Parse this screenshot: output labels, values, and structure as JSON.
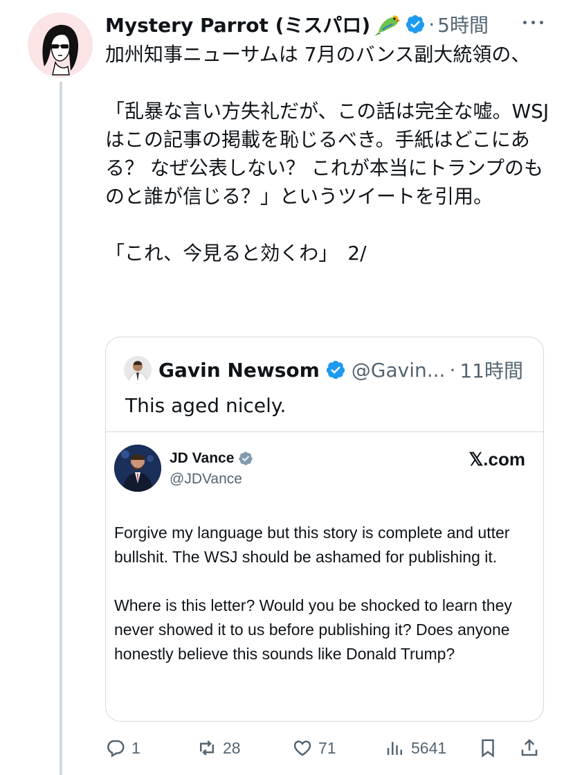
{
  "post": {
    "author_name": "Mystery Parrot (ミスパロ)",
    "separator": "·",
    "time": "5時間",
    "text": "加州知事ニューサムは 7月のバンス副大統領の、\n\n「乱暴な言い方失礼だが、この話は完全な嘘。WSJ はこの記事の掲載を恥じるべき。手紙はどこにある？ なぜ公表しない？ これが本当にトランプのものと誰が信じる？」というツイートを引用。\n\n「これ、今見ると効くわ」　2/"
  },
  "quote": {
    "author_name": "Gavin Newsom",
    "handle": "@Gavin...",
    "separator": "·",
    "time": "11時間",
    "text": "This aged nicely.",
    "embed": {
      "author_name": "JD Vance",
      "handle": "@JDVance",
      "source": "𝕏.com",
      "text": "Forgive my language but this story is complete and utter bullshit. The WSJ should be ashamed for publishing it.\n\nWhere is this letter? Would you be shocked to learn they never showed it to us before publishing it? Does anyone honestly believe this sounds like Donald Trump?"
    }
  },
  "actions": {
    "replies": "1",
    "reposts": "28",
    "likes": "71",
    "views": "5641"
  },
  "colors": {
    "verified": "#1d9bf0",
    "secondary_text": "#536471",
    "border": "#cfd9de"
  }
}
